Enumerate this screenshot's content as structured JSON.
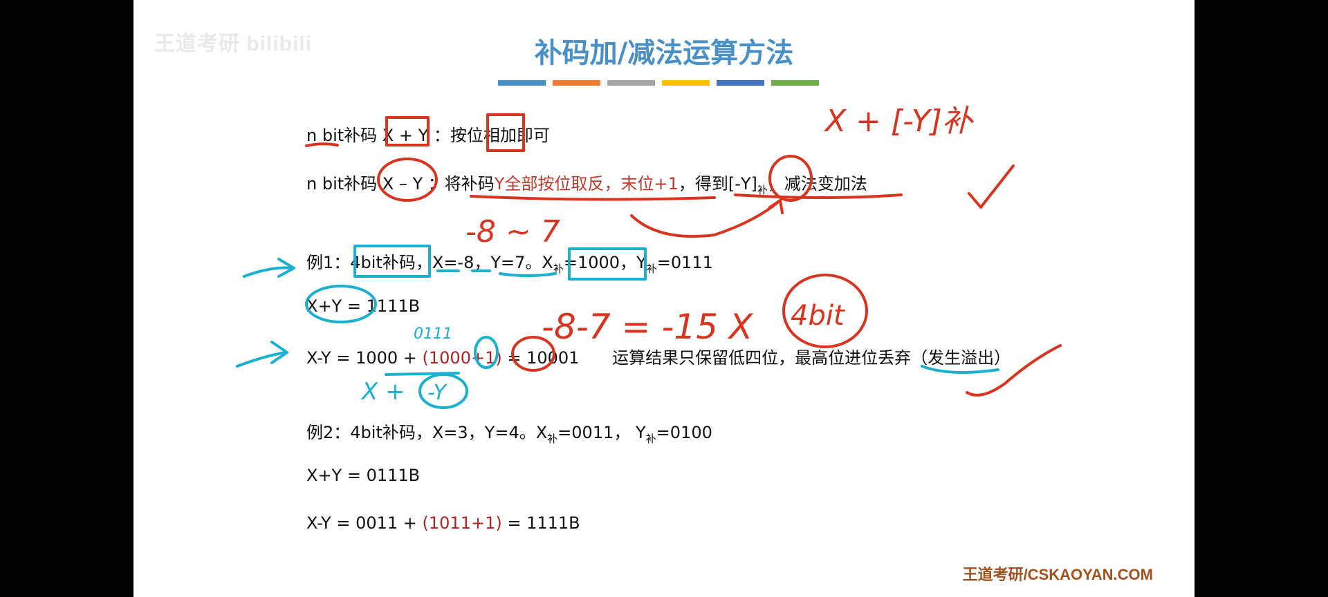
{
  "watermark": "王道考研 bilibili",
  "title": "补码加/减法运算方法",
  "colors": [
    "#4472c4",
    "#ed7d31",
    "#a5a5a5",
    "#ffc000",
    "#4472c4",
    "#70ad47"
  ],
  "lines": {
    "l1": {
      "a": "n bit补码",
      "b": "X + Y",
      "c": "：按位相加即可"
    },
    "l2": {
      "a": "n bit补码",
      "b": "X – Y",
      "c": "：将补码",
      "d": "Y全部按位取反，末位+1",
      "e": "，得到",
      "f": "[-Y]",
      "g": "补",
      "h": "，减法变加法"
    },
    "e1": {
      "a": "例1：",
      "b": "4bit补码",
      "c": "，X=-8，Y=7。X",
      "d": "补",
      "e": "=1000，Y",
      "f": "补",
      "g": "=0111"
    },
    "e1_add": {
      "a": "X+Y = 1111B"
    },
    "e1_sub": {
      "a": "X-Y = 1000 + ",
      "b": "(1000+1)",
      "c": " = 10001",
      "d": "运算结果只保留低四位，最高位进位丢弃（发生溢出）"
    },
    "e2": {
      "a": "例2：4bit补码，X=3，Y=4。X",
      "b": "补",
      "c": "=0011， Y",
      "d": "补",
      "e": "=0100"
    },
    "e2_add": {
      "a": "X+Y = 0111B"
    },
    "e2_sub": {
      "a": "X-Y = 0011 + ",
      "b": "(1011+1)",
      "c": " = 1111B"
    }
  },
  "handwriting": {
    "top_right": "X + [-Y]补",
    "minus8": "-8 ~ 7",
    "overflow": "-8-7 = -15 X",
    "fourbit": "4bit",
    "small_0111": "0111",
    "x_plus": "X +",
    "neg_y": "-Y"
  },
  "footer": "王道考研/CSKAOYAN.COM"
}
